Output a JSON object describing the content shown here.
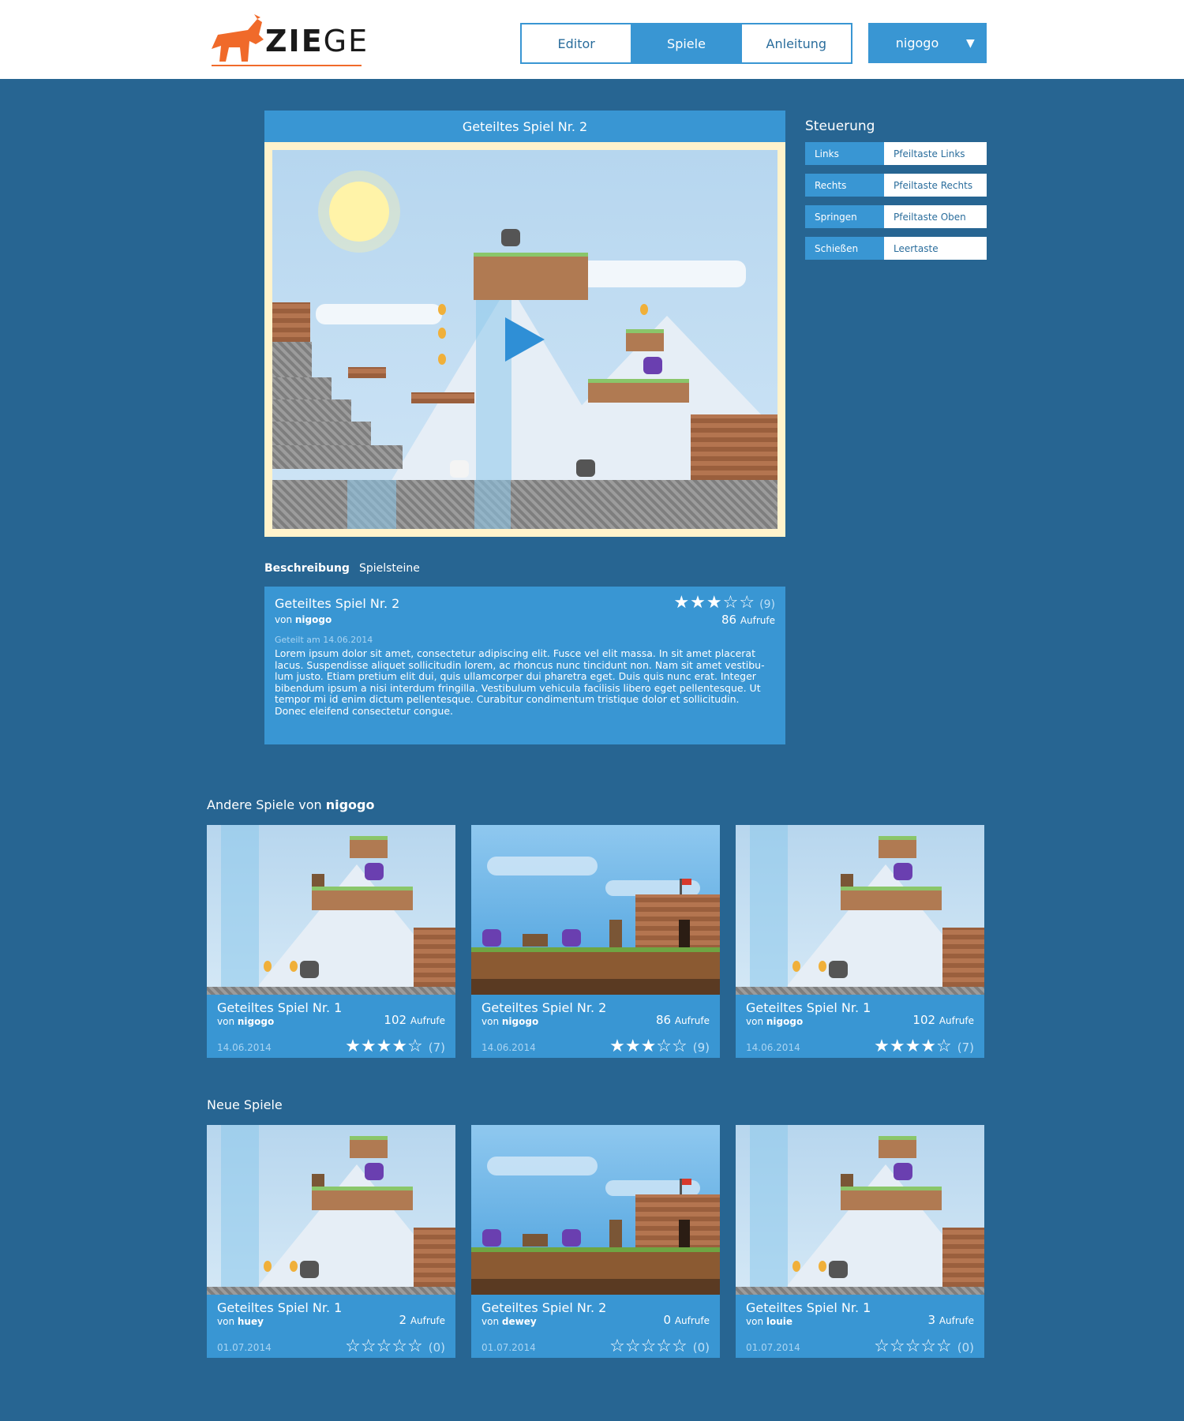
{
  "header": {
    "logo_text_bold": "ZIE",
    "logo_text_rest": "GE",
    "nav": [
      {
        "label": "Editor",
        "active": false
      },
      {
        "label": "Spiele",
        "active": true
      },
      {
        "label": "Anleitung",
        "active": false
      }
    ],
    "user": "nigogo",
    "user_caret": "▼"
  },
  "viewer": {
    "title": "Geteiltes Spiel Nr. 2",
    "play_icon": "play-icon"
  },
  "controls": {
    "title": "Steuerung",
    "rows": [
      {
        "action": "Links",
        "key": "Pfeiltaste Links"
      },
      {
        "action": "Rechts",
        "key": "Pfeiltaste Rechts"
      },
      {
        "action": "Springen",
        "key": "Pfeiltaste Oben"
      },
      {
        "action": "Schießen",
        "key": "Leertaste"
      }
    ]
  },
  "tabs": [
    {
      "label": "Beschreibung",
      "active": true
    },
    {
      "label": "Spielsteine",
      "active": false
    }
  ],
  "description": {
    "title": "Geteiltes Spiel Nr. 2",
    "by_prefix": "von",
    "author": "nigogo",
    "stars": "★★★☆☆",
    "rating_count": "(9)",
    "views": "86",
    "views_label": "Aufrufe",
    "date": "Geteilt am 14.06.2014",
    "text": "Lorem ipsum dolor sit amet, consectetur adipiscing elit. Fusce vel elit massa. In sit amet placerat lacus. Suspendisse aliquet sollicitudin lorem, ac rhoncus nunc tincidunt non. Nam sit amet vestibu-lum justo. Etiam pretium elit dui, quis ullamcorper dui pharetra eget. Duis quis nunc erat. Integer bibendum ipsum a nisi interdum fringilla. Vestibulum vehicula facilisis libero eget pellentesque. Ut tempor mi id enim dictum pellentesque. Curabitur condimentum tristique dolor et sollicitudin. Donec eleifend consectetur congue."
  },
  "other_games": {
    "title_prefix": "Andere Spiele von",
    "title_author": "nigogo",
    "cards": [
      {
        "title": "Geteiltes Spiel Nr. 1",
        "by_prefix": "von",
        "author": "nigogo",
        "views": "102",
        "views_label": "Aufrufe",
        "date": "14.06.2014",
        "stars": "★★★★☆",
        "count": "(7)",
        "scene": "mountain"
      },
      {
        "title": "Geteiltes Spiel Nr. 2",
        "by_prefix": "von",
        "author": "nigogo",
        "views": "86",
        "views_label": "Aufrufe",
        "date": "14.06.2014",
        "stars": "★★★☆☆",
        "count": "(9)",
        "scene": "castle"
      },
      {
        "title": "Geteiltes Spiel Nr. 1",
        "by_prefix": "von",
        "author": "nigogo",
        "views": "102",
        "views_label": "Aufrufe",
        "date": "14.06.2014",
        "stars": "★★★★☆",
        "count": "(7)",
        "scene": "mountain"
      }
    ]
  },
  "new_games": {
    "title": "Neue Spiele",
    "cards": [
      {
        "title": "Geteiltes Spiel Nr. 1",
        "by_prefix": "von",
        "author": "huey",
        "views": "2",
        "views_label": "Aufrufe",
        "date": "01.07.2014",
        "stars": "☆☆☆☆☆",
        "count": "(0)",
        "scene": "mountain"
      },
      {
        "title": "Geteiltes Spiel Nr. 2",
        "by_prefix": "von",
        "author": "dewey",
        "views": "0",
        "views_label": "Aufrufe",
        "date": "01.07.2014",
        "stars": "☆☆☆☆☆",
        "count": "(0)",
        "scene": "castle"
      },
      {
        "title": "Geteiltes Spiel Nr. 1",
        "by_prefix": "von",
        "author": "louie",
        "views": "3",
        "views_label": "Aufrufe",
        "date": "01.07.2014",
        "stars": "☆☆☆☆☆",
        "count": "(0)",
        "scene": "mountain"
      }
    ]
  },
  "colors": {
    "page_bg": "#276592",
    "accent": "#3996d3",
    "logo_orange": "#f06a2a"
  }
}
